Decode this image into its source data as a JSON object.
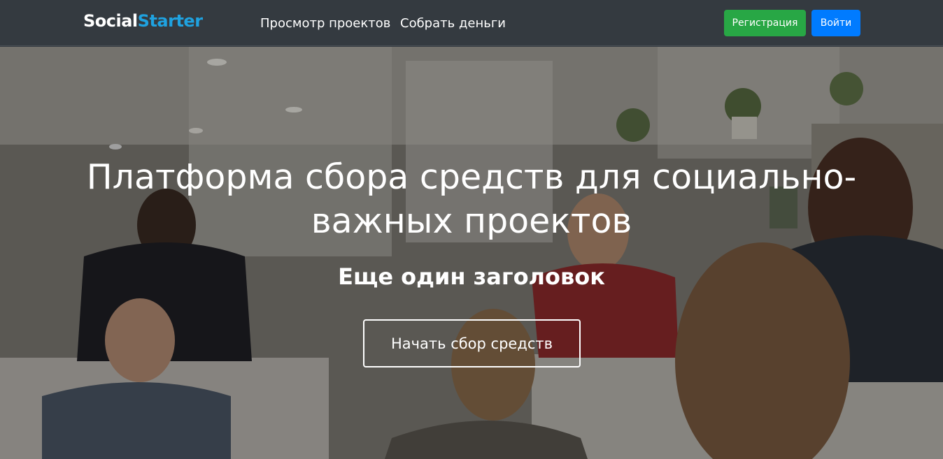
{
  "brand": {
    "name_part1": "Social",
    "name_part2": "Starter",
    "accent_color": "#1fa2e0"
  },
  "nav": {
    "links": [
      {
        "label": "Просмотр проектов"
      },
      {
        "label": "Собрать деньги"
      }
    ],
    "register_label": "Регистрация",
    "login_label": "Войти",
    "register_color": "#28a745",
    "login_color": "#007bff",
    "bar_color": "#343a40"
  },
  "hero": {
    "title_line1": "Платформа сбора средств для социально-",
    "title_line2": "важных проектов",
    "subtitle": "Еще один заголовок",
    "cta_label": "Начать сбор средств",
    "background_image": "office-team-meeting-photo"
  }
}
